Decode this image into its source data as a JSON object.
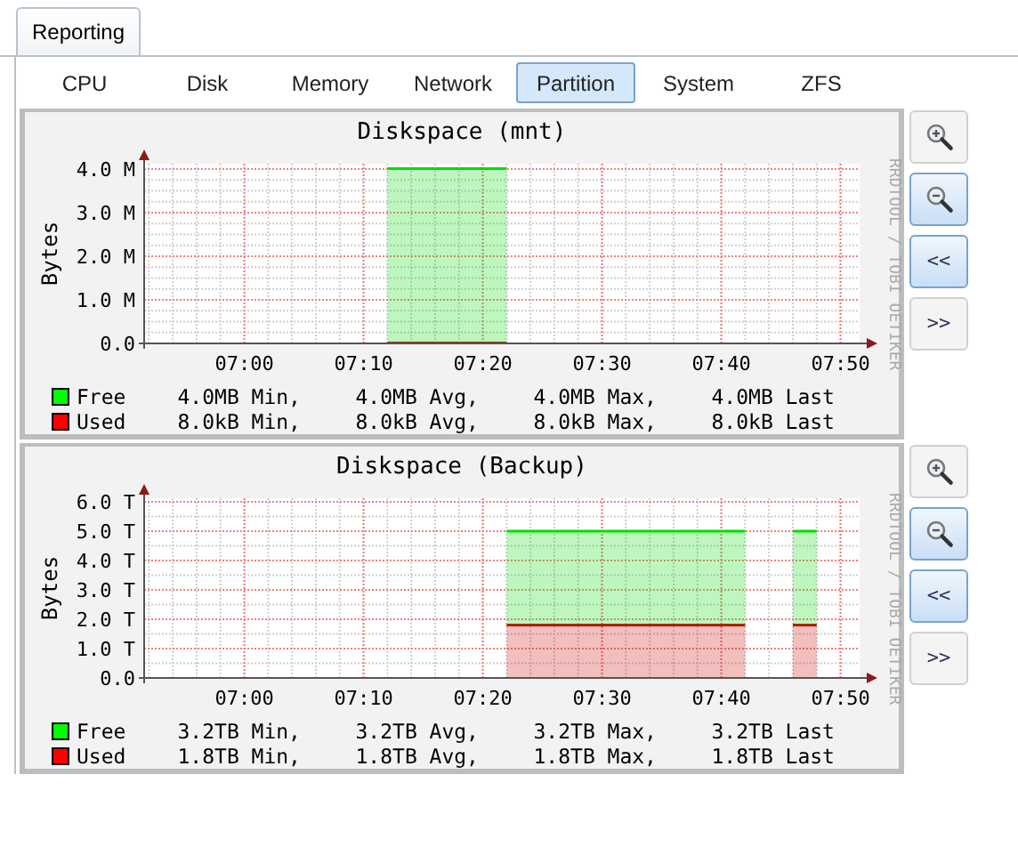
{
  "tabs": [
    {
      "label": "Reporting",
      "selected": true
    }
  ],
  "subtabs": [
    {
      "label": "CPU",
      "selected": false
    },
    {
      "label": "Disk",
      "selected": false
    },
    {
      "label": "Memory",
      "selected": false
    },
    {
      "label": "Network",
      "selected": false
    },
    {
      "label": "Partition",
      "selected": true
    },
    {
      "label": "System",
      "selected": false
    },
    {
      "label": "ZFS",
      "selected": false
    }
  ],
  "graphs": [
    {
      "watermark": "RRDTOOL / TOBI OETIKER",
      "chart_data": {
        "type": "area",
        "stacked": true,
        "grid": true,
        "title": "Diskspace (mnt)",
        "ylabel": "Bytes",
        "categories": [
          null,
          null,
          null,
          null,
          "07:00",
          null,
          null,
          null,
          null,
          "07:10",
          null,
          null,
          null,
          null,
          "07:20",
          null,
          null,
          null,
          null,
          "07:30",
          null,
          null,
          null,
          null,
          "07:40",
          null,
          null,
          null,
          null,
          "07:50"
        ],
        "series": [
          {
            "name": "Used",
            "color": "#cc0000",
            "values": [
              null,
              null,
              null,
              null,
              null,
              null,
              null,
              null,
              null,
              null,
              0.01,
              0.01,
              0.01,
              0.01,
              0.01,
              0.01,
              null,
              null,
              null,
              null,
              null,
              null,
              null,
              null,
              null,
              null,
              null,
              null,
              null,
              null
            ]
          },
          {
            "name": "Free",
            "color": "#00dd00",
            "values": [
              null,
              null,
              null,
              null,
              null,
              null,
              null,
              null,
              null,
              null,
              4.0,
              4.0,
              4.0,
              4.0,
              4.0,
              4.0,
              null,
              null,
              null,
              null,
              null,
              null,
              null,
              null,
              null,
              null,
              null,
              null,
              null,
              null
            ]
          }
        ],
        "ylim": [
          0,
          4.12
        ],
        "yticks": [
          {
            "value": 0,
            "label": "0.0"
          },
          {
            "value": 1,
            "label": "1.0 M"
          },
          {
            "value": 2,
            "label": "2.0 M"
          },
          {
            "value": 3,
            "label": "3.0 M"
          },
          {
            "value": 4,
            "label": "4.0 M"
          }
        ]
      },
      "legend": [
        {
          "color": "#00ff00",
          "min": "4.0MB Min,",
          "avg": "4.0MB Avg,",
          "max": "4.0MB Max,",
          "last": "4.0MB Last"
        },
        {
          "color": "#ff0000",
          "min": "8.0kB Min,",
          "avg": "8.0kB Avg,",
          "max": "8.0kB Max,",
          "last": "8.0kB Last"
        }
      ],
      "buttons": [
        {
          "kind": "zoom-in",
          "active": false
        },
        {
          "kind": "zoom-out",
          "active": true
        },
        {
          "kind": "text",
          "label": "<<",
          "active": true
        },
        {
          "kind": "text",
          "label": ">>",
          "active": false
        }
      ]
    },
    {
      "watermark": "RRDTOOL / TOBI OETIKER",
      "chart_data": {
        "type": "area",
        "stacked": true,
        "grid": true,
        "title": "Diskspace (Backup)",
        "ylabel": "Bytes",
        "categories": [
          null,
          null,
          null,
          null,
          "07:00",
          null,
          null,
          null,
          null,
          "07:10",
          null,
          null,
          null,
          null,
          "07:20",
          null,
          null,
          null,
          null,
          "07:30",
          null,
          null,
          null,
          null,
          "07:40",
          null,
          null,
          null,
          null,
          "07:50"
        ],
        "series": [
          {
            "name": "Used",
            "color": "#cc0000",
            "values": [
              null,
              null,
              null,
              null,
              null,
              null,
              null,
              null,
              null,
              null,
              null,
              null,
              null,
              null,
              null,
              1.8,
              1.8,
              1.8,
              1.8,
              1.8,
              1.8,
              1.8,
              1.8,
              1.8,
              1.8,
              1.8,
              null,
              1.8,
              1.8,
              null
            ]
          },
          {
            "name": "Free",
            "color": "#00dd00",
            "values": [
              null,
              null,
              null,
              null,
              null,
              null,
              null,
              null,
              null,
              null,
              null,
              null,
              null,
              null,
              null,
              3.2,
              3.2,
              3.2,
              3.2,
              3.2,
              3.2,
              3.2,
              3.2,
              3.2,
              3.2,
              3.2,
              null,
              3.2,
              3.2,
              null
            ]
          }
        ],
        "ylim": [
          0,
          6.12
        ],
        "yticks": [
          {
            "value": 0,
            "label": "0.0"
          },
          {
            "value": 1,
            "label": "1.0 T"
          },
          {
            "value": 2,
            "label": "2.0 T"
          },
          {
            "value": 3,
            "label": "3.0 T"
          },
          {
            "value": 4,
            "label": "4.0 T"
          },
          {
            "value": 5,
            "label": "5.0 T"
          },
          {
            "value": 6,
            "label": "6.0 T"
          }
        ]
      },
      "legend": [
        {
          "color": "#00ff00",
          "min": "3.2TB Min,",
          "avg": "3.2TB Avg,",
          "max": "3.2TB Max,",
          "last": "3.2TB Last"
        },
        {
          "color": "#ff0000",
          "min": "1.8TB Min,",
          "avg": "1.8TB Avg,",
          "max": "1.8TB Max,",
          "last": "1.8TB Last"
        }
      ],
      "buttons": [
        {
          "kind": "zoom-in",
          "active": false
        },
        {
          "kind": "zoom-out",
          "active": true
        },
        {
          "kind": "text",
          "label": "<<",
          "active": true
        },
        {
          "kind": "text",
          "label": ">>",
          "active": false
        }
      ]
    }
  ]
}
